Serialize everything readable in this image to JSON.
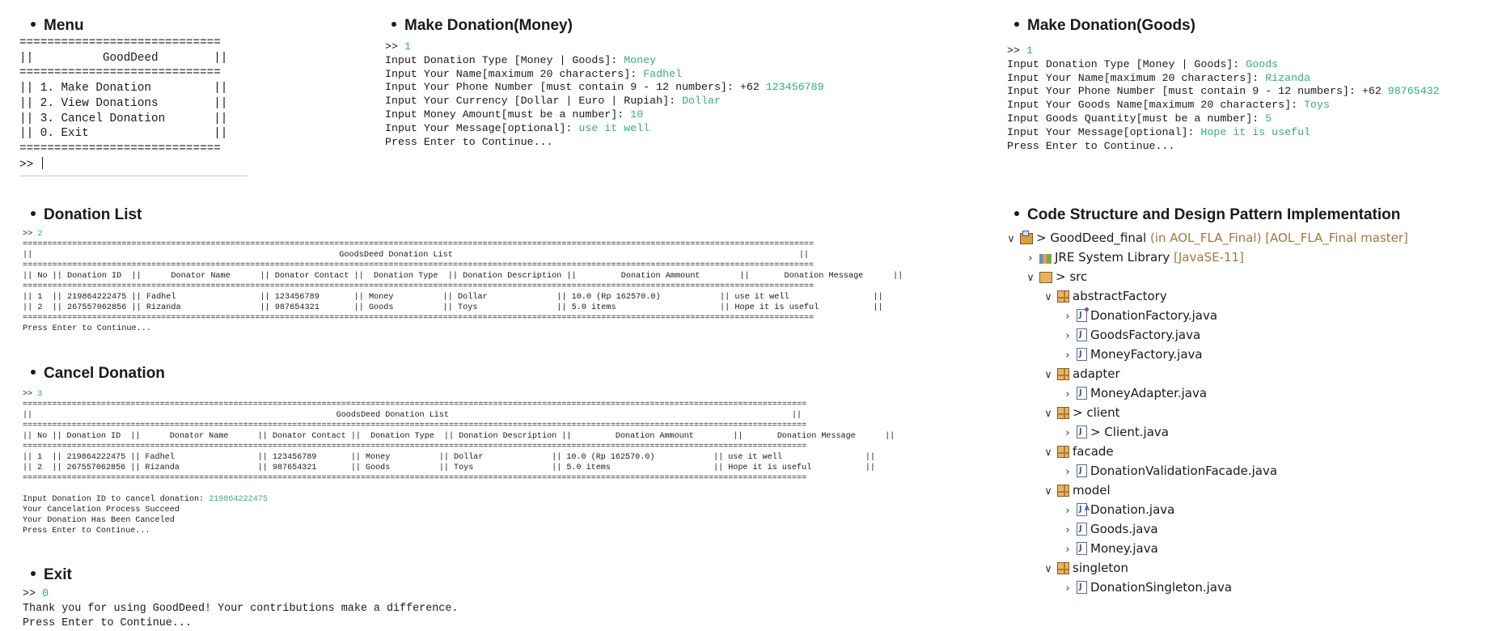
{
  "sections": {
    "menu": "Menu",
    "make_money": "Make Donation(Money)",
    "make_goods": "Make Donation(Goods)",
    "donation_list": "Donation List",
    "cancel": "Cancel Donation",
    "exit": "Exit",
    "code_structure": "Code Structure and Design Pattern Implementation"
  },
  "menu": {
    "sep": "=============================",
    "title_line": "||          GoodDeed        ||",
    "items": [
      "|| 1. Make Donation         ||",
      "|| 2. View Donations        ||",
      "|| 3. Cancel Donation       ||",
      "|| 0. Exit                  ||"
    ],
    "prompt": ">> "
  },
  "money": {
    "prompt": ">> ",
    "choice": "1",
    "lines": [
      {
        "label": "Input Donation Type [Money | Goods]: ",
        "value": "Money"
      },
      {
        "label": "Input Your Name[maximum 20 characters]: ",
        "value": "Fadhel"
      },
      {
        "label": "Input Your Phone Number [must contain 9 - 12 numbers]: +62 ",
        "value": "123456789"
      },
      {
        "label": "Input Your Currency [Dollar | Euro | Rupiah]: ",
        "value": "Dollar"
      },
      {
        "label": "Input Money Amount[must be a number]: ",
        "value": "10"
      },
      {
        "label": "Input Your Message[optional]: ",
        "value": "use it well"
      }
    ],
    "continue": "Press Enter to Continue..."
  },
  "goods": {
    "prompt": ">> ",
    "choice": "1",
    "lines": [
      {
        "label": "Input Donation Type [Money | Goods]: ",
        "value": "Goods"
      },
      {
        "label": "Input Your Name[maximum 20 characters]: ",
        "value": "Rizanda"
      },
      {
        "label": "Input Your Phone Number [must contain 9 - 12 numbers]: +62 ",
        "value": "98765432"
      },
      {
        "label": "Input Your Goods Name[maximum 20 characters]: ",
        "value": "Toys"
      },
      {
        "label": "Input Goods Quantity[must be a number]: ",
        "value": "5"
      },
      {
        "label": "Input Your Message[optional]: ",
        "value": "Hope it is useful"
      }
    ],
    "continue": "Press Enter to Continue..."
  },
  "list": {
    "prompt": ">> ",
    "choice": "2",
    "sep": "================================================================================================================================================================",
    "title_line": "||                                                              GoodsDeed Donation List                                                                      ||",
    "header_line": "|| No || Donation ID  ||      Donator Name      || Donator Contact ||  Donation Type  || Donation Description ||         Donation Ammount        ||       Donation Message      ||",
    "rows": [
      "|| 1  || 219864222475 || Fadhel                 || 123456789       || Money          || Dollar              || 10.0 (Rp 162570.0)            || use it well                 ||",
      "|| 2  || 267557062856 || Rizanda                || 987654321       || Goods          || Toys                || 5.0 items                     || Hope it is useful           ||"
    ],
    "continue": "Press Enter to Continue..."
  },
  "cancel": {
    "prompt": ">> ",
    "choice": "3",
    "id_label": "Input Donation ID to cancel donation: ",
    "id_value": "219864222475",
    "msg1": "Your Cancelation Process Succeed",
    "msg2": "Your Donation Has Been Canceled",
    "continue": "Press Enter to Continue..."
  },
  "exit": {
    "prompt": ">> ",
    "choice": "0",
    "thanks": "Thank you for using GoodDeed! Your contributions make a difference.",
    "continue": "Press Enter to Continue..."
  },
  "tree": {
    "project": "> GoodDeed_final",
    "project_info": " (in AOL_FLA_Final) [AOL_FLA_Final master]",
    "jre": "JRE System Library",
    "jre_info": " [JavaSE-11]",
    "src": "> src",
    "packages": [
      {
        "name": "abstractFactory",
        "files": [
          "DonationFactory.java",
          "GoodsFactory.java",
          "MoneyFactory.java"
        ]
      },
      {
        "name": "adapter",
        "files": [
          "MoneyAdapter.java"
        ]
      },
      {
        "name": "> client",
        "files": [
          "> Client.java"
        ]
      },
      {
        "name": "facade",
        "files": [
          "DonationValidationFacade.java"
        ]
      },
      {
        "name": "model",
        "files": [
          "Donation.java",
          "Goods.java",
          "Money.java"
        ]
      },
      {
        "name": "singleton",
        "files": [
          "DonationSingleton.java"
        ]
      }
    ]
  }
}
